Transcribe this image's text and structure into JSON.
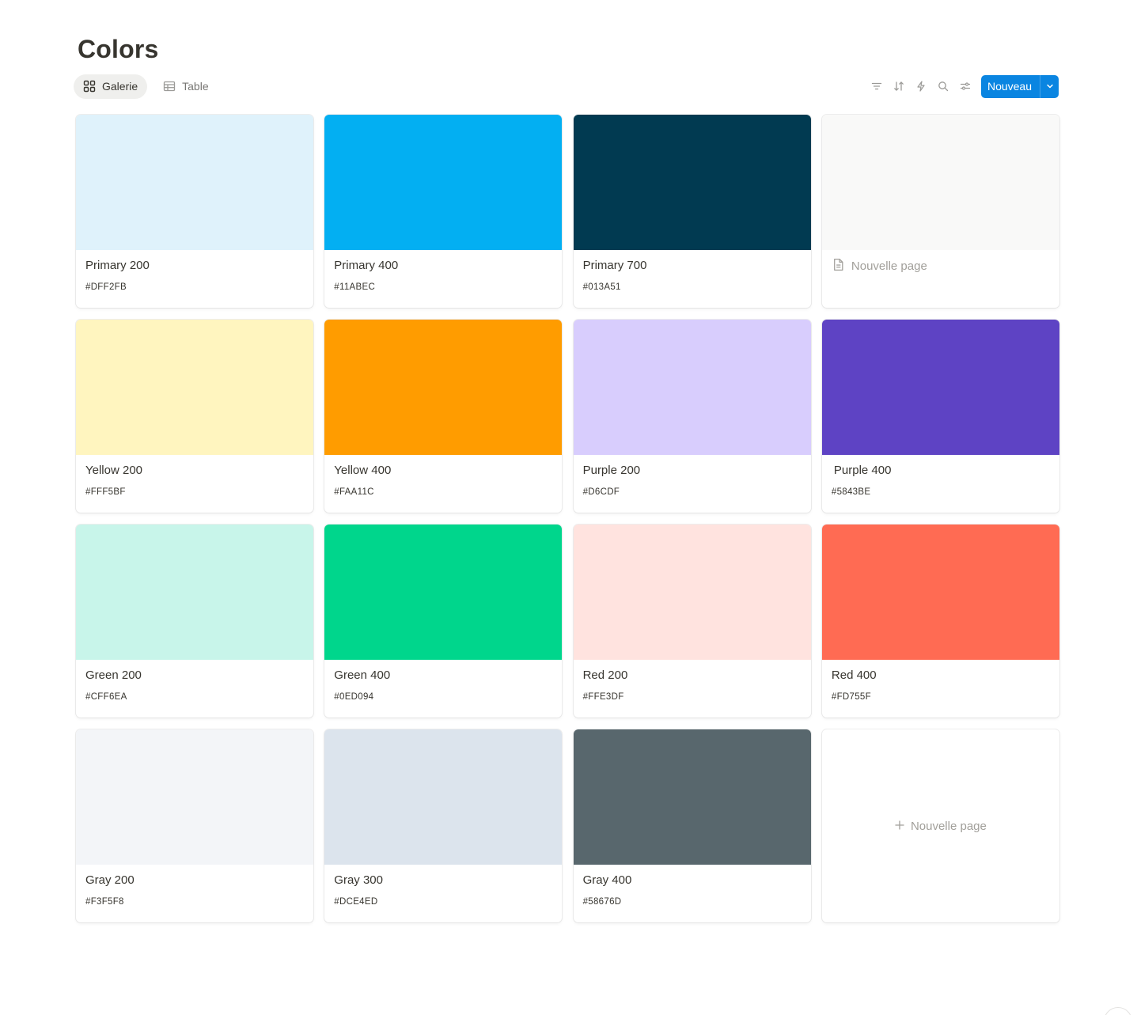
{
  "page": {
    "title": "Colors"
  },
  "views": [
    {
      "label": "Galerie",
      "icon": "gallery-icon",
      "active": true
    },
    {
      "label": "Table",
      "icon": "table-icon",
      "active": false
    }
  ],
  "toolbar": {
    "icons": [
      "filter-icon",
      "sort-icon",
      "automation-icon",
      "search-icon",
      "settings-icon"
    ],
    "new_label": "Nouveau"
  },
  "cards": [
    {
      "name": "Primary 200",
      "hex": "#DFF2FB",
      "swatch": "#DFF2FB"
    },
    {
      "name": "Primary 400",
      "hex": "#11ABEC",
      "swatch": "#03AFF2"
    },
    {
      "name": "Primary 700",
      "hex": "#013A51",
      "swatch": "#013A51"
    },
    {
      "name": "Yellow 200",
      "hex": "#FFF5BF",
      "swatch": "#FFF5BF"
    },
    {
      "name": "Yellow 400",
      "hex": "#FAA11C",
      "swatch": "#FF9C00"
    },
    {
      "name": "Purple 200",
      "hex": "#D6CDF",
      "swatch": "#D8CDFD"
    },
    {
      "name": "Purple 400",
      "hex": "#5843BE",
      "swatch": "#5E43C4"
    },
    {
      "name": "Green 200",
      "hex": "#CFF6EA",
      "swatch": "#C8F5EA"
    },
    {
      "name": "Green 400",
      "hex": "#0ED094",
      "swatch": "#00D68C"
    },
    {
      "name": "Red 200",
      "hex": "#FFE3DF",
      "swatch": "#FFE3DF"
    },
    {
      "name": "Red 400",
      "hex": "#FD755F",
      "swatch": "#FF6B53"
    },
    {
      "name": "Gray 200",
      "hex": "#F3F5F8",
      "swatch": "#F3F5F8"
    },
    {
      "name": "Gray 300",
      "hex": "#DCE4ED",
      "swatch": "#DCE4ED"
    },
    {
      "name": "Gray 400",
      "hex": "#58676D",
      "swatch": "#58676D"
    }
  ],
  "new_page_label": "Nouvelle page",
  "new_page_card_label": "Nouvelle page"
}
